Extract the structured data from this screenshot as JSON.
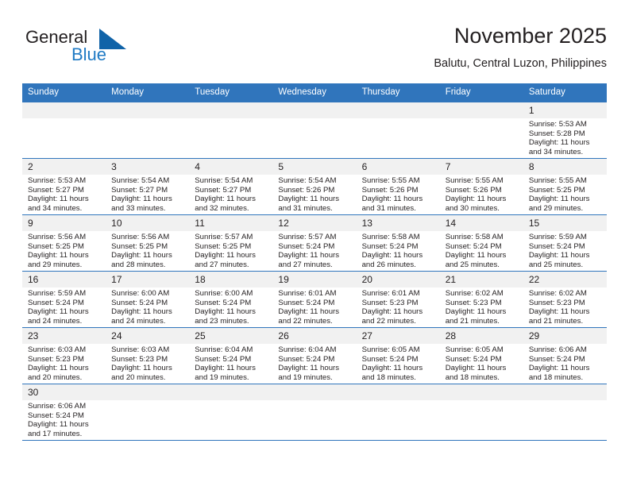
{
  "branding": {
    "logo_text_primary": "General",
    "logo_text_secondary": "Blue",
    "logo_icon": "triangle-flag-icon",
    "primary_color": "#3075bc",
    "accent_color": "#1f7ac4",
    "header_band_color": "#f1f1f1"
  },
  "header": {
    "title": "November 2025",
    "subtitle": "Balutu, Central Luzon, Philippines"
  },
  "calendar": {
    "weekday_headers": [
      "Sunday",
      "Monday",
      "Tuesday",
      "Wednesday",
      "Thursday",
      "Friday",
      "Saturday"
    ],
    "labels": {
      "sunrise": "Sunrise:",
      "sunset": "Sunset:",
      "daylight": "Daylight:"
    },
    "weeks": [
      [
        {
          "day": "",
          "sunrise": "",
          "sunset": "",
          "daylight_line1": "",
          "daylight_line2": ""
        },
        {
          "day": "",
          "sunrise": "",
          "sunset": "",
          "daylight_line1": "",
          "daylight_line2": ""
        },
        {
          "day": "",
          "sunrise": "",
          "sunset": "",
          "daylight_line1": "",
          "daylight_line2": ""
        },
        {
          "day": "",
          "sunrise": "",
          "sunset": "",
          "daylight_line1": "",
          "daylight_line2": ""
        },
        {
          "day": "",
          "sunrise": "",
          "sunset": "",
          "daylight_line1": "",
          "daylight_line2": ""
        },
        {
          "day": "",
          "sunrise": "",
          "sunset": "",
          "daylight_line1": "",
          "daylight_line2": ""
        },
        {
          "day": "1",
          "sunrise": "Sunrise: 5:53 AM",
          "sunset": "Sunset: 5:28 PM",
          "daylight_line1": "Daylight: 11 hours",
          "daylight_line2": "and 34 minutes."
        }
      ],
      [
        {
          "day": "2",
          "sunrise": "Sunrise: 5:53 AM",
          "sunset": "Sunset: 5:27 PM",
          "daylight_line1": "Daylight: 11 hours",
          "daylight_line2": "and 34 minutes."
        },
        {
          "day": "3",
          "sunrise": "Sunrise: 5:54 AM",
          "sunset": "Sunset: 5:27 PM",
          "daylight_line1": "Daylight: 11 hours",
          "daylight_line2": "and 33 minutes."
        },
        {
          "day": "4",
          "sunrise": "Sunrise: 5:54 AM",
          "sunset": "Sunset: 5:27 PM",
          "daylight_line1": "Daylight: 11 hours",
          "daylight_line2": "and 32 minutes."
        },
        {
          "day": "5",
          "sunrise": "Sunrise: 5:54 AM",
          "sunset": "Sunset: 5:26 PM",
          "daylight_line1": "Daylight: 11 hours",
          "daylight_line2": "and 31 minutes."
        },
        {
          "day": "6",
          "sunrise": "Sunrise: 5:55 AM",
          "sunset": "Sunset: 5:26 PM",
          "daylight_line1": "Daylight: 11 hours",
          "daylight_line2": "and 31 minutes."
        },
        {
          "day": "7",
          "sunrise": "Sunrise: 5:55 AM",
          "sunset": "Sunset: 5:26 PM",
          "daylight_line1": "Daylight: 11 hours",
          "daylight_line2": "and 30 minutes."
        },
        {
          "day": "8",
          "sunrise": "Sunrise: 5:55 AM",
          "sunset": "Sunset: 5:25 PM",
          "daylight_line1": "Daylight: 11 hours",
          "daylight_line2": "and 29 minutes."
        }
      ],
      [
        {
          "day": "9",
          "sunrise": "Sunrise: 5:56 AM",
          "sunset": "Sunset: 5:25 PM",
          "daylight_line1": "Daylight: 11 hours",
          "daylight_line2": "and 29 minutes."
        },
        {
          "day": "10",
          "sunrise": "Sunrise: 5:56 AM",
          "sunset": "Sunset: 5:25 PM",
          "daylight_line1": "Daylight: 11 hours",
          "daylight_line2": "and 28 minutes."
        },
        {
          "day": "11",
          "sunrise": "Sunrise: 5:57 AM",
          "sunset": "Sunset: 5:25 PM",
          "daylight_line1": "Daylight: 11 hours",
          "daylight_line2": "and 27 minutes."
        },
        {
          "day": "12",
          "sunrise": "Sunrise: 5:57 AM",
          "sunset": "Sunset: 5:24 PM",
          "daylight_line1": "Daylight: 11 hours",
          "daylight_line2": "and 27 minutes."
        },
        {
          "day": "13",
          "sunrise": "Sunrise: 5:58 AM",
          "sunset": "Sunset: 5:24 PM",
          "daylight_line1": "Daylight: 11 hours",
          "daylight_line2": "and 26 minutes."
        },
        {
          "day": "14",
          "sunrise": "Sunrise: 5:58 AM",
          "sunset": "Sunset: 5:24 PM",
          "daylight_line1": "Daylight: 11 hours",
          "daylight_line2": "and 25 minutes."
        },
        {
          "day": "15",
          "sunrise": "Sunrise: 5:59 AM",
          "sunset": "Sunset: 5:24 PM",
          "daylight_line1": "Daylight: 11 hours",
          "daylight_line2": "and 25 minutes."
        }
      ],
      [
        {
          "day": "16",
          "sunrise": "Sunrise: 5:59 AM",
          "sunset": "Sunset: 5:24 PM",
          "daylight_line1": "Daylight: 11 hours",
          "daylight_line2": "and 24 minutes."
        },
        {
          "day": "17",
          "sunrise": "Sunrise: 6:00 AM",
          "sunset": "Sunset: 5:24 PM",
          "daylight_line1": "Daylight: 11 hours",
          "daylight_line2": "and 24 minutes."
        },
        {
          "day": "18",
          "sunrise": "Sunrise: 6:00 AM",
          "sunset": "Sunset: 5:24 PM",
          "daylight_line1": "Daylight: 11 hours",
          "daylight_line2": "and 23 minutes."
        },
        {
          "day": "19",
          "sunrise": "Sunrise: 6:01 AM",
          "sunset": "Sunset: 5:24 PM",
          "daylight_line1": "Daylight: 11 hours",
          "daylight_line2": "and 22 minutes."
        },
        {
          "day": "20",
          "sunrise": "Sunrise: 6:01 AM",
          "sunset": "Sunset: 5:23 PM",
          "daylight_line1": "Daylight: 11 hours",
          "daylight_line2": "and 22 minutes."
        },
        {
          "day": "21",
          "sunrise": "Sunrise: 6:02 AM",
          "sunset": "Sunset: 5:23 PM",
          "daylight_line1": "Daylight: 11 hours",
          "daylight_line2": "and 21 minutes."
        },
        {
          "day": "22",
          "sunrise": "Sunrise: 6:02 AM",
          "sunset": "Sunset: 5:23 PM",
          "daylight_line1": "Daylight: 11 hours",
          "daylight_line2": "and 21 minutes."
        }
      ],
      [
        {
          "day": "23",
          "sunrise": "Sunrise: 6:03 AM",
          "sunset": "Sunset: 5:23 PM",
          "daylight_line1": "Daylight: 11 hours",
          "daylight_line2": "and 20 minutes."
        },
        {
          "day": "24",
          "sunrise": "Sunrise: 6:03 AM",
          "sunset": "Sunset: 5:23 PM",
          "daylight_line1": "Daylight: 11 hours",
          "daylight_line2": "and 20 minutes."
        },
        {
          "day": "25",
          "sunrise": "Sunrise: 6:04 AM",
          "sunset": "Sunset: 5:24 PM",
          "daylight_line1": "Daylight: 11 hours",
          "daylight_line2": "and 19 minutes."
        },
        {
          "day": "26",
          "sunrise": "Sunrise: 6:04 AM",
          "sunset": "Sunset: 5:24 PM",
          "daylight_line1": "Daylight: 11 hours",
          "daylight_line2": "and 19 minutes."
        },
        {
          "day": "27",
          "sunrise": "Sunrise: 6:05 AM",
          "sunset": "Sunset: 5:24 PM",
          "daylight_line1": "Daylight: 11 hours",
          "daylight_line2": "and 18 minutes."
        },
        {
          "day": "28",
          "sunrise": "Sunrise: 6:05 AM",
          "sunset": "Sunset: 5:24 PM",
          "daylight_line1": "Daylight: 11 hours",
          "daylight_line2": "and 18 minutes."
        },
        {
          "day": "29",
          "sunrise": "Sunrise: 6:06 AM",
          "sunset": "Sunset: 5:24 PM",
          "daylight_line1": "Daylight: 11 hours",
          "daylight_line2": "and 18 minutes."
        }
      ],
      [
        {
          "day": "30",
          "sunrise": "Sunrise: 6:06 AM",
          "sunset": "Sunset: 5:24 PM",
          "daylight_line1": "Daylight: 11 hours",
          "daylight_line2": "and 17 minutes."
        },
        {
          "day": "",
          "sunrise": "",
          "sunset": "",
          "daylight_line1": "",
          "daylight_line2": ""
        },
        {
          "day": "",
          "sunrise": "",
          "sunset": "",
          "daylight_line1": "",
          "daylight_line2": ""
        },
        {
          "day": "",
          "sunrise": "",
          "sunset": "",
          "daylight_line1": "",
          "daylight_line2": ""
        },
        {
          "day": "",
          "sunrise": "",
          "sunset": "",
          "daylight_line1": "",
          "daylight_line2": ""
        },
        {
          "day": "",
          "sunrise": "",
          "sunset": "",
          "daylight_line1": "",
          "daylight_line2": ""
        },
        {
          "day": "",
          "sunrise": "",
          "sunset": "",
          "daylight_line1": "",
          "daylight_line2": ""
        }
      ]
    ]
  }
}
